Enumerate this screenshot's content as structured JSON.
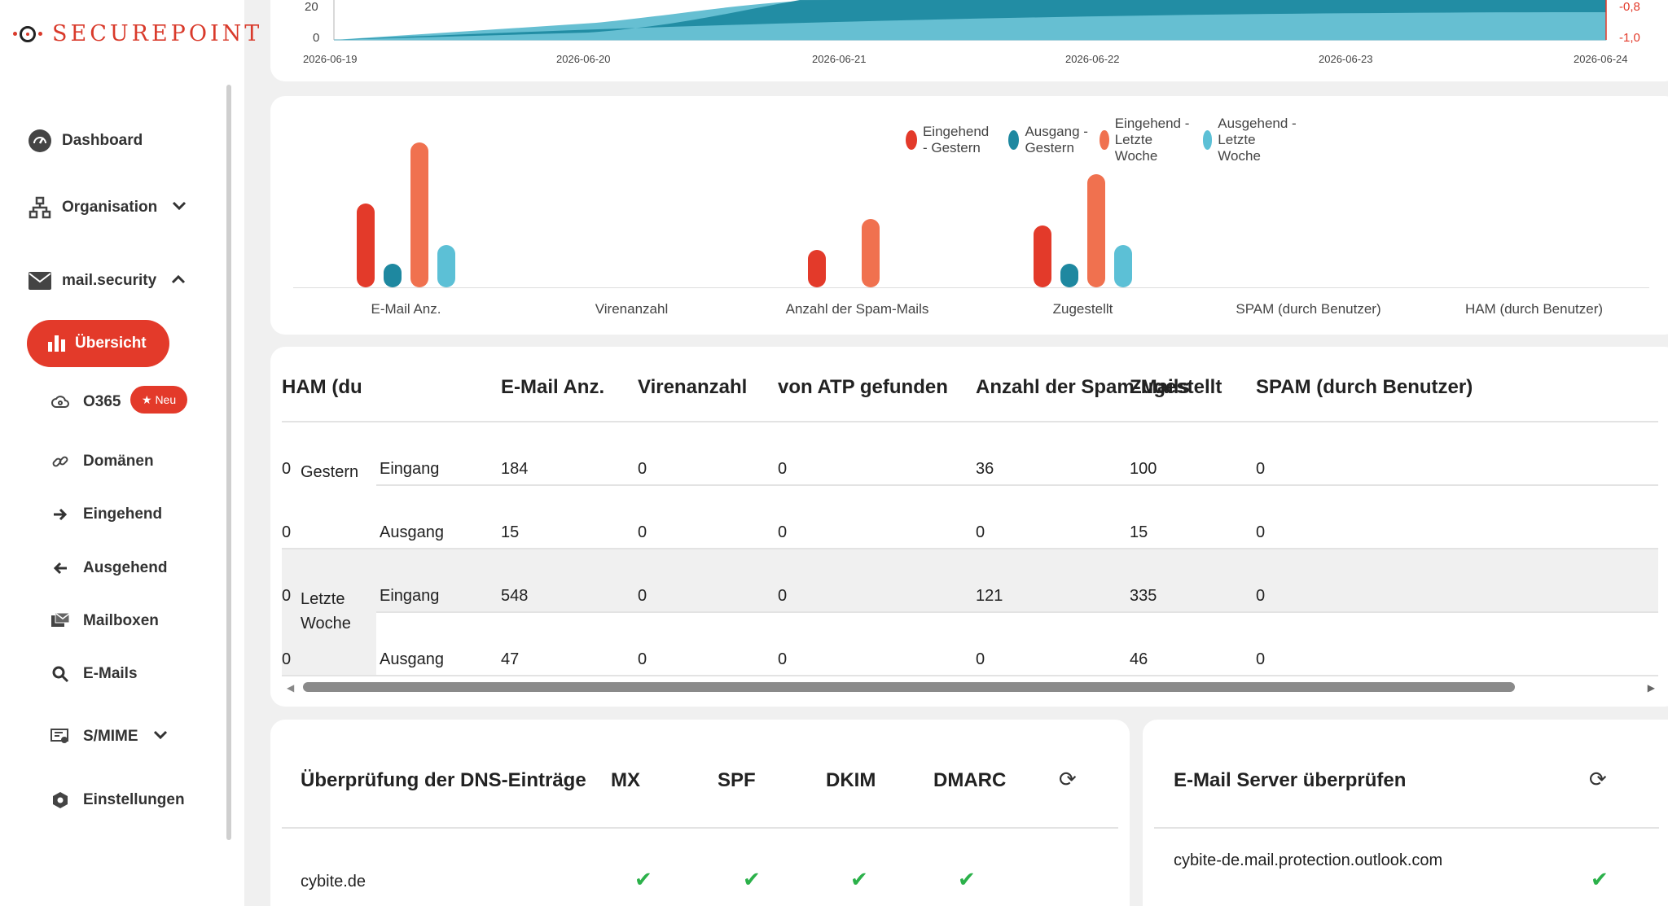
{
  "brand": {
    "name": "SECUREPOINT"
  },
  "colors": {
    "accent": "#e33a2a",
    "incoming_yesterday": "#e33a2a",
    "outgoing_yesterday": "#1e88a0",
    "incoming_last_week": "#f0714f",
    "outgoing_last_week": "#5cc0d6",
    "check": "#2bb14a"
  },
  "sidebar": {
    "dashboard": "Dashboard",
    "organisation": "Organisation",
    "mailsecurity": "mail.security",
    "uebersicht": "Übersicht",
    "o365": "O365",
    "neu_badge": "★ Neu",
    "domaenen": "Domänen",
    "eingehend": "Eingehend",
    "ausgehend": "Ausgehend",
    "mailboxen": "Mailboxen",
    "emails": "E-Mails",
    "smime": "S/MIME",
    "einstellungen": "Einstellungen"
  },
  "area_chart": {
    "y_ticks": [
      "20",
      "0"
    ],
    "y_right_ticks": [
      "-0,8",
      "-1,0"
    ],
    "x_ticks": [
      "2026-06-19",
      "2026-06-20",
      "2026-06-21",
      "2026-06-22",
      "2026-06-23",
      "2026-06-24"
    ]
  },
  "chart_data": {
    "type": "bar",
    "categories": [
      "E-Mail Anz.",
      "Virenanzahl",
      "Anzahl der Spam-Mails",
      "Zugestellt",
      "SPAM (durch Benutzer)",
      "HAM (durch Benutzer)"
    ],
    "series": [
      {
        "name": "Eingehend - Gestern",
        "values": [
          184,
          0,
          36,
          100,
          0,
          0
        ]
      },
      {
        "name": "Ausgang - Gestern",
        "values": [
          15,
          0,
          0,
          15,
          0,
          0
        ]
      },
      {
        "name": "Eingehend - Letzte Woche",
        "values": [
          548,
          0,
          121,
          335,
          0,
          0
        ]
      },
      {
        "name": "Ausgehend - Letzte Woche",
        "values": [
          47,
          0,
          0,
          46,
          0,
          0
        ]
      }
    ],
    "legend": "top-right",
    "grid": false
  },
  "table": {
    "headers": [
      "E-Mail Anz.",
      "Virenanzahl",
      "von ATP gefunden",
      "Anzahl der Spam-Mails",
      "Zugestellt",
      "SPAM (durch Benutzer)",
      "HAM (du"
    ],
    "groups": [
      {
        "label": "Gestern",
        "rows": [
          {
            "dir": "Eingang",
            "values": [
              "184",
              "0",
              "0",
              "36",
              "100",
              "0",
              "0"
            ]
          },
          {
            "dir": "Ausgang",
            "values": [
              "15",
              "0",
              "0",
              "0",
              "15",
              "0",
              "0"
            ]
          }
        ]
      },
      {
        "label": "Letzte Woche",
        "rows": [
          {
            "dir": "Eingang",
            "values": [
              "548",
              "0",
              "0",
              "121",
              "335",
              "0",
              "0"
            ]
          },
          {
            "dir": "Ausgang",
            "values": [
              "47",
              "0",
              "0",
              "0",
              "46",
              "0",
              "0"
            ]
          }
        ]
      }
    ]
  },
  "dns": {
    "title": "Überprüfung der DNS-Einträge",
    "cols": [
      "MX",
      "SPF",
      "DKIM",
      "DMARC"
    ],
    "rows": [
      {
        "domain": "cybite.de",
        "checks": [
          true,
          true,
          true,
          true
        ]
      }
    ]
  },
  "server": {
    "title": "E-Mail Server überprüfen",
    "rows": [
      {
        "host": "cybite-de.mail.protection.outlook.com",
        "ok": true
      }
    ]
  }
}
